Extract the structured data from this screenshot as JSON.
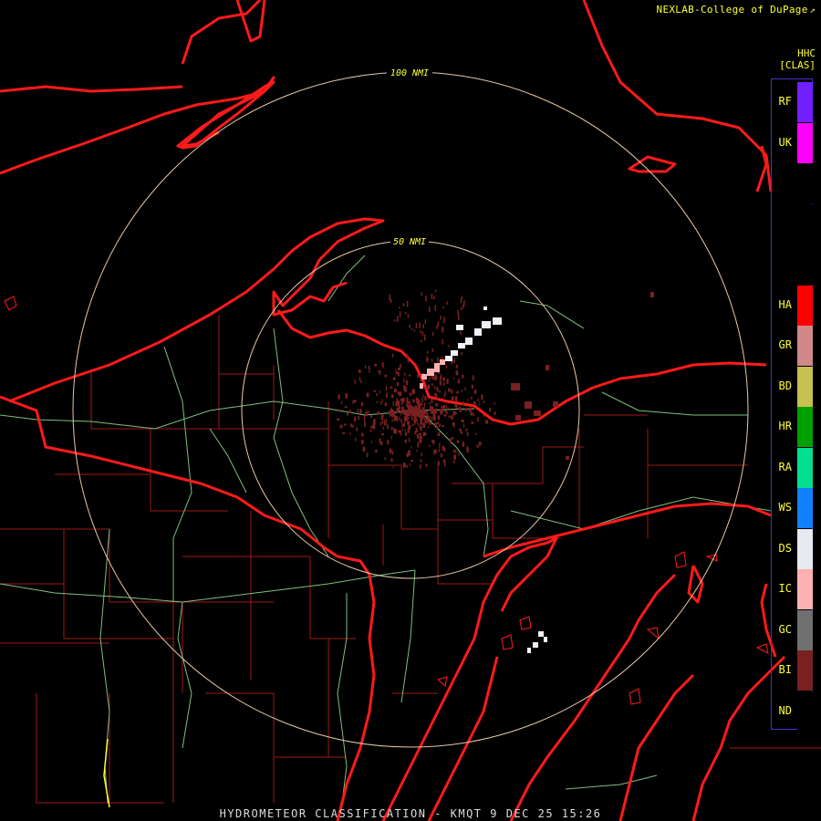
{
  "header": {
    "credit": "NEXLAB-College of DuPage",
    "credit_icon": "external-link-icon"
  },
  "map": {
    "range_rings": [
      {
        "label": "100 NMI",
        "radius_nmi": 100
      },
      {
        "label": "50 NMI",
        "radius_nmi": 50
      }
    ],
    "colors": {
      "state_borders": "#ff1a1a",
      "county_borders": "#a01818",
      "roads": "#7fbf7f",
      "range_rings": "#e8c8a8",
      "ring_labels": "#ffff33",
      "background": "#000000"
    }
  },
  "legend": {
    "product": "HHC",
    "units": "[CLAS]",
    "classes": [
      {
        "code": "RF",
        "color": "#7020ff"
      },
      {
        "code": "UK",
        "color": "#ff00ff"
      },
      {
        "code": "",
        "color": "#000000"
      },
      {
        "code": "",
        "color": "#000000"
      },
      {
        "code": "",
        "color": "#000000"
      },
      {
        "code": "HA",
        "color": "#ff0000"
      },
      {
        "code": "GR",
        "color": "#d08888"
      },
      {
        "code": "BD",
        "color": "#c8c050"
      },
      {
        "code": "HR",
        "color": "#00a000"
      },
      {
        "code": "RA",
        "color": "#00e090"
      },
      {
        "code": "WS",
        "color": "#1080ff"
      },
      {
        "code": "DS",
        "color": "#e8e8f0"
      },
      {
        "code": "IC",
        "color": "#ffb0b0"
      },
      {
        "code": "GC",
        "color": "#707070"
      },
      {
        "code": "BI",
        "color": "#7a2020"
      },
      {
        "code": "ND",
        "color": "#000000"
      }
    ]
  },
  "footer": {
    "title": "HYDROMETEOR CLASSIFICATION - KMQT 9 DEC 25 15:26"
  }
}
